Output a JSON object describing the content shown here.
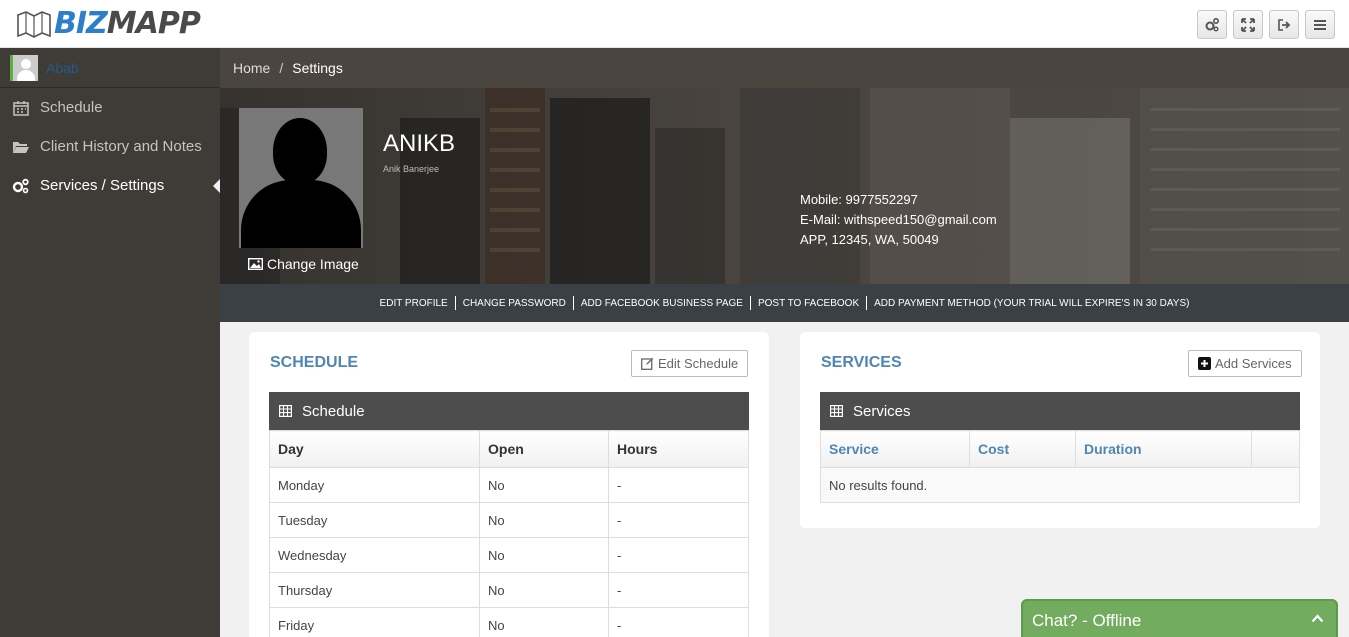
{
  "header": {
    "logo_biz": "BIZ",
    "logo_mapp": "MAPP",
    "buttons": [
      {
        "name": "settings-gears-button",
        "icon": "gears-icon"
      },
      {
        "name": "fullscreen-button",
        "icon": "expand-icon"
      },
      {
        "name": "logout-button",
        "icon": "sign-out-icon"
      },
      {
        "name": "menu-button",
        "icon": "hamburger-icon"
      }
    ]
  },
  "sidebar": {
    "user_name": "Abab",
    "items": [
      {
        "label": "Schedule",
        "icon": "calendar-icon"
      },
      {
        "label": "Client History and Notes",
        "icon": "folder-open-icon"
      },
      {
        "label": "Services / Settings",
        "icon": "gears-icon",
        "active": true
      }
    ]
  },
  "breadcrumb": {
    "home": "Home",
    "separator": "/",
    "current": "Settings"
  },
  "profile": {
    "name": "ANIKB",
    "full_name": "Anik Banerjee",
    "change_image": "Change Image",
    "mobile": "Mobile: 9977552297",
    "email": "E-Mail: withspeed150@gmail.com",
    "address": "APP, 12345, WA, 50049"
  },
  "actions": [
    "EDIT PROFILE",
    "CHANGE PASSWORD",
    "ADD FACEBOOK BUSINESS PAGE",
    "POST TO FACEBOOK",
    "ADD PAYMENT METHOD (YOUR TRIAL WILL EXPIRE'S IN 30 DAYS)"
  ],
  "schedule": {
    "title": "SCHEDULE",
    "edit_button": "Edit Schedule",
    "table_title": "Schedule",
    "columns": [
      "Day",
      "Open",
      "Hours"
    ],
    "rows": [
      [
        "Monday",
        "No",
        "-"
      ],
      [
        "Tuesday",
        "No",
        "-"
      ],
      [
        "Wednesday",
        "No",
        "-"
      ],
      [
        "Thursday",
        "No",
        "-"
      ],
      [
        "Friday",
        "No",
        "-"
      ]
    ]
  },
  "services": {
    "title": "SERVICES",
    "add_button": "Add Services",
    "table_title": "Services",
    "columns": [
      "Service",
      "Cost",
      "Duration",
      ""
    ],
    "empty_text": "No results found."
  },
  "chat": {
    "label": "Chat? - Offline"
  },
  "colors": {
    "sidebar_bg": "#3f3b36",
    "accent_blue": "#4f86b4",
    "chat_green": "#73ac5f"
  }
}
